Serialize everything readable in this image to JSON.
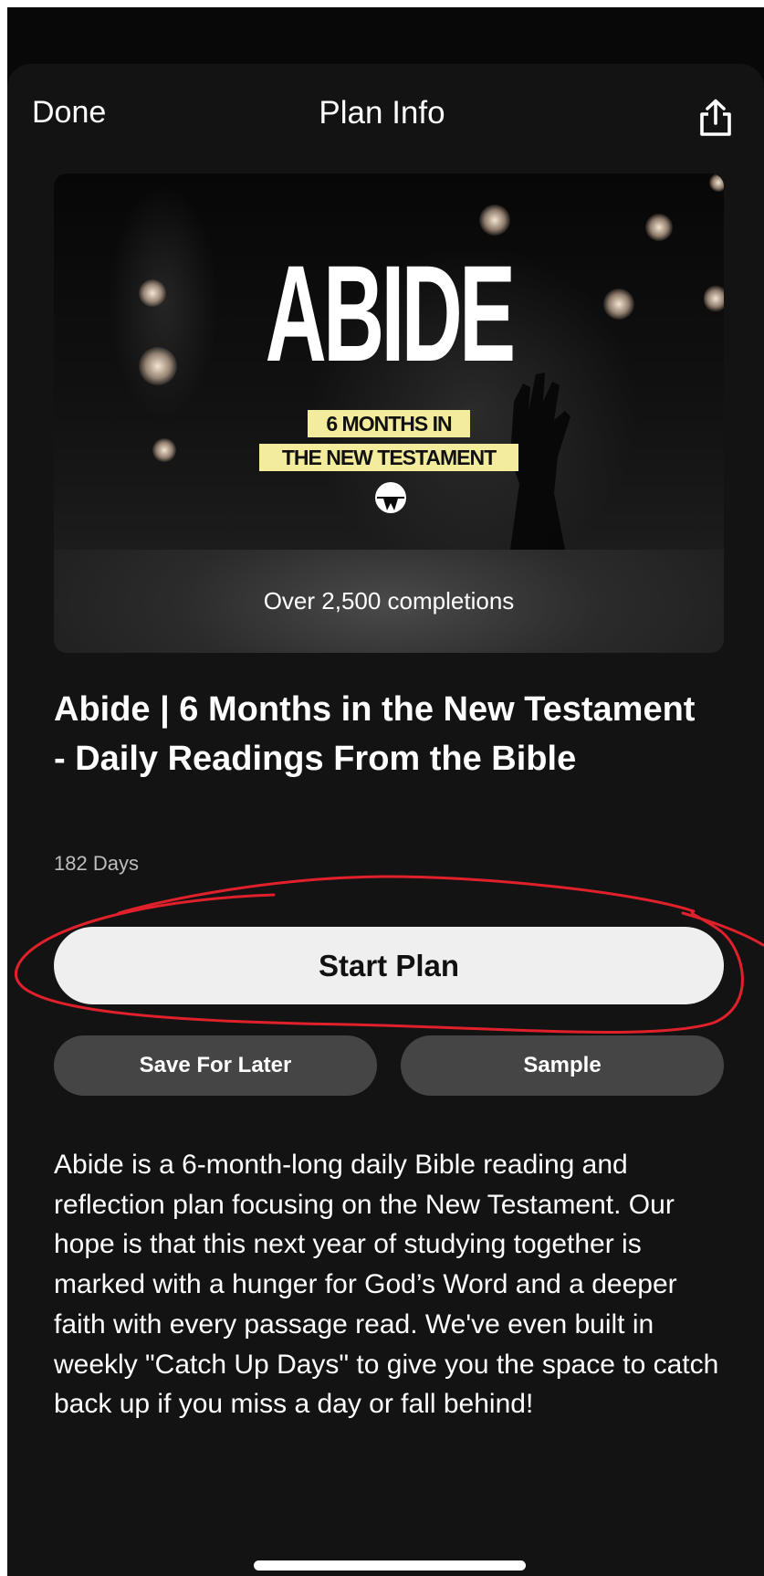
{
  "nav": {
    "done_label": "Done",
    "title": "Plan Info",
    "share_icon": "share-icon"
  },
  "cover": {
    "title": "ABIDE",
    "tag_line_1": "6 MONTHS IN",
    "tag_line_2": "THE NEW TESTAMENT",
    "tag_color": "#f4ec9d"
  },
  "card": {
    "completions": "Over 2,500 completions"
  },
  "plan": {
    "title": "Abide | 6 Months in the New Testament - Daily Readings From the Bible",
    "days": "182 Days",
    "start_label": "Start Plan",
    "save_label": "Save For Later",
    "sample_label": "Sample",
    "description": "Abide is a 6-month-long daily Bible reading and reflection plan focusing on the New Testament. Our hope is that this next year of studying together is marked with a hunger for God’s Word and a deeper faith with every passage read. We've even built in weekly \"Catch Up Days\" to give you the space to catch back up if you miss a day or fall behind!"
  },
  "annotation": {
    "color": "#e0202b"
  }
}
